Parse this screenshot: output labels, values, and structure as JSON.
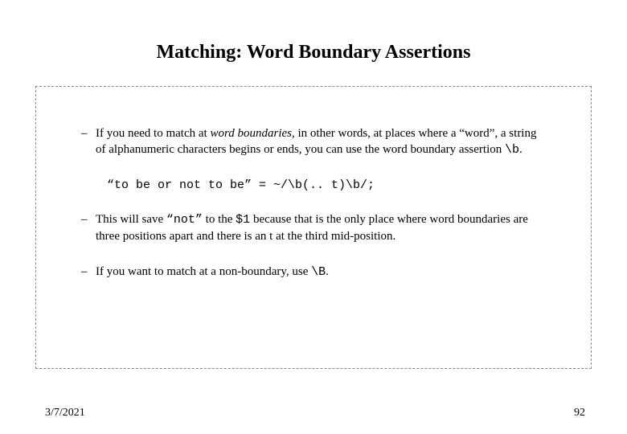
{
  "title": "Matching: Word Boundary Assertions",
  "bullets": {
    "b1_pre": "If you need to match at ",
    "b1_italic": "word boundaries",
    "b1_mid": ", in other words, at places where a “word”, a string of alphanumeric characters begins or ends, you can use the word boundary assertion ",
    "b1_code": "\\b",
    "b1_post": ".",
    "code_example": "“to be or not to be” = ~/\\b(.. t)\\b/;",
    "b2_pre": "This will save ",
    "b2_code1": "“not”",
    "b2_mid1": " to the ",
    "b2_code2": "$1",
    "b2_post": " because that is the only place where word boundaries are three positions apart and there is an t at the third mid-position.",
    "b3_pre": "If you want to match at a non-boundary, use ",
    "b3_code": "\\B",
    "b3_post": "."
  },
  "footer": {
    "date": "3/7/2021",
    "page": "92"
  }
}
